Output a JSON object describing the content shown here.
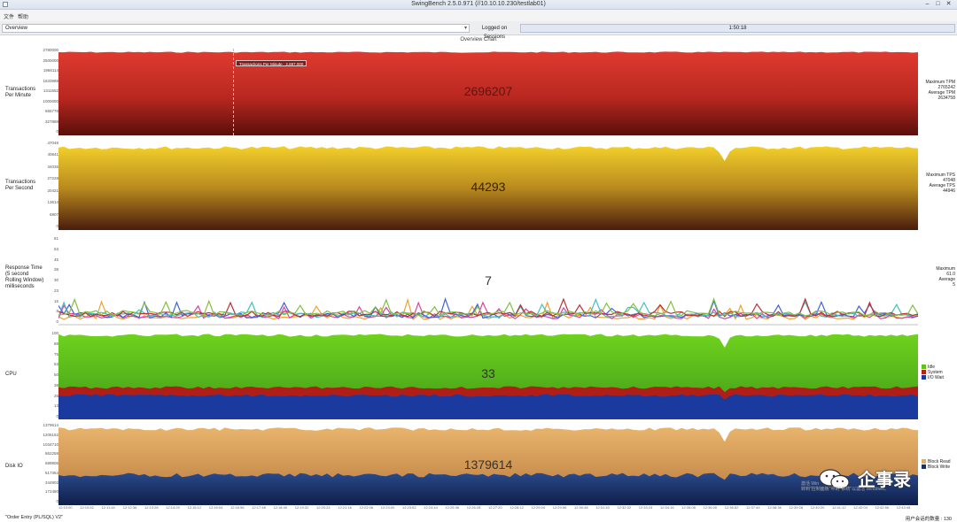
{
  "window": {
    "title": "SwingBench 2.5.0.971  (//10.10.10.230/testlab01)"
  },
  "menu": {
    "items": [
      "文件",
      "帮助"
    ]
  },
  "toolbar": {
    "chart_selector_value": "Overview",
    "sessions_label": "Logged on Sessions",
    "elapsed_time": "1:50:18"
  },
  "overview_title": "Overview Chart",
  "panels": {
    "tpm": {
      "label_line1": "Transactions",
      "label_line2": "Per Minute",
      "value": "2696207",
      "stats": [
        "Maximum TPM",
        "2765242",
        "Average TPM",
        "2634758"
      ],
      "ticks": [
        "2780000",
        "2500000",
        "1966114",
        "1633988",
        "1311552",
        "1000000",
        "655776",
        "327888",
        "0"
      ],
      "tooltip": "Transactions Per Minute : 2,697,000",
      "color": "#d8302b"
    },
    "tps": {
      "label_line1": "Transactions",
      "label_line2": "Per Second",
      "value": "44293",
      "stats": [
        "Maximum TPS",
        "47048",
        "Average TPS",
        "44946"
      ],
      "ticks": [
        "47048",
        "40841",
        "34035",
        "27228",
        "20421",
        "13614",
        "6807",
        "0"
      ],
      "color": "#e8c420"
    },
    "response": {
      "label_line1": "Response Time",
      "label_line2": "(5 second",
      "label_line3": "Rolling Window)",
      "label_line4": "milliseconds",
      "value": "7",
      "stats": [
        "Maximum",
        "61.0",
        "Average",
        "5"
      ],
      "ticks": [
        "61",
        "53",
        "45",
        "38",
        "30",
        "23",
        "15",
        "8",
        "0"
      ],
      "series_colors": [
        "#f0a030",
        "#e040a0",
        "#4060e0",
        "#40c0c0",
        "#c03030",
        "#80c040"
      ]
    },
    "cpu": {
      "label": "CPU",
      "value": "33",
      "ticks": [
        "100",
        "88",
        "75",
        "63",
        "50",
        "38",
        "25",
        "13",
        "0"
      ],
      "legend": [
        {
          "name": "Idle",
          "color": "#5cc21c"
        },
        {
          "name": "System",
          "color": "#b8201a"
        },
        {
          "name": "I/O Wait",
          "color": "#1a3aa0"
        }
      ]
    },
    "diskio": {
      "label": "Disk IO",
      "value": "1379614",
      "ticks": [
        "1379614",
        "1206162",
        "1034710",
        "862258",
        "689806",
        "517354",
        "344902",
        "172450",
        "0"
      ],
      "legend": [
        {
          "name": "Block Read",
          "color": "#e2ad6a"
        },
        {
          "name": "Block Write",
          "color": "#1a3070"
        }
      ]
    }
  },
  "time_axis": [
    "12:10:00",
    "12:10:52",
    "12:11:44",
    "12:12:36",
    "12:13:28",
    "12:14:20",
    "12:15:12",
    "12:16:04",
    "12:16:56",
    "12:17:48",
    "12:18:40",
    "12:19:32",
    "12:20:24",
    "12:21:16",
    "12:22:08",
    "12:23:00",
    "12:23:52",
    "12:24:44",
    "12:25:36",
    "12:26:28",
    "12:27:20",
    "12:28:12",
    "12:29:04",
    "12:29:56",
    "12:30:48",
    "12:31:40",
    "12:32:32",
    "12:33:24",
    "12:34:16",
    "12:35:08",
    "12:36:00",
    "12:36:52",
    "12:37:44",
    "12:38:36",
    "12:39:28",
    "12:40:20",
    "12:41:12",
    "12:42:04",
    "12:42:56",
    "12:43:48"
  ],
  "status": {
    "left": "\"Order Entry (PL/SQL) V2\"",
    "right": "用户会话的数量 : 130"
  },
  "watermark": {
    "line1": "激活 Win",
    "line2": "转到\"控制面板\"中的\"系统\"以激活 Windows。",
    "brand": "企事录"
  }
}
